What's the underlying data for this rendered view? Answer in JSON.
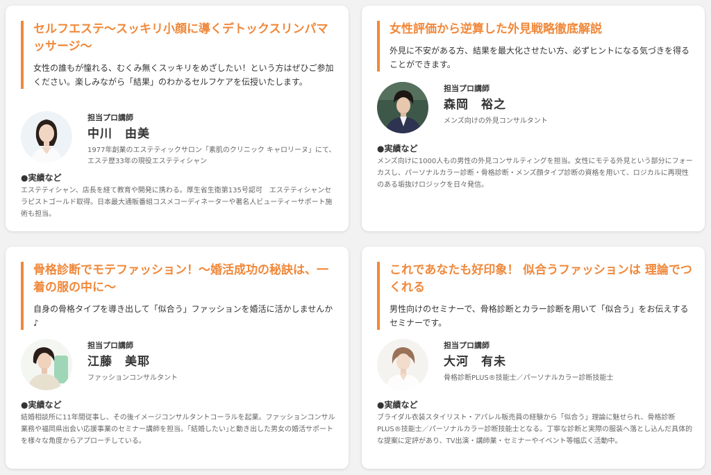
{
  "cards": [
    {
      "title": "セルフエステ〜スッキリ小顔に導くデトックスリンパマッサージ〜",
      "description": "女性の誰もが憧れる、むくみ無くスッキリをめざしたい！という方はぜひご参加ください。楽しみながら「結果」のわかるセルフケアを伝授いたします。",
      "role": "担当プロ講師",
      "name": "中川　由美",
      "profile": "1977年創業のエステティックサロン「素肌のクリニック キャロリーヌ」にて、エステ歴33年の現役エステティシャン",
      "achievements_heading": "●実績など",
      "achievements": "エステティシャン、店長を経て教育や開発に携わる。厚生省生衛第135号認可　エステティシャンセラピストゴールド取得。日本最大通販番組コスメコーディネーターや著名人ビューティーサポート施術も担当。"
    },
    {
      "title": "女性評価から逆算した外見戦略徹底解説",
      "description": "外見に不安がある方、結果を最大化させたい方、必ずヒントになる気づきを得ることができます。",
      "role": "担当プロ講師",
      "name": "森岡　裕之",
      "profile": "メンズ向けの外見コンサルタント",
      "achievements_heading": "●実績など",
      "achievements": "メンズ向けに1000人もの男性の外見コンサルティングを担当。女性にモテる外見という部分にフォーカスし、パーソナルカラー診断・骨格診断・メンズ顔タイプ診断の資格を用いて、ロジカルに再現性のある垢抜けロジックを日々発信。"
    },
    {
      "title": "骨格診断でモテファッション！〜婚活成功の秘訣は、一着の服の中に〜",
      "description": "自身の骨格タイプを導き出して「似合う」ファッションを婚活に活かしませんか♪",
      "role": "担当プロ講師",
      "name": "江藤　美耶",
      "profile": "ファッションコンサルタント",
      "achievements_heading": "●実績など",
      "achievements": "結婚相談所に11年間従事し、その後イメージコンサルタントコーラルを起業。ファッションコンサル業務や福岡県出会い応援事業のセミナー講師を担当。｢結婚したい｣と動き出した男女の婚活サポートを様々な角度からアプローチしている。"
    },
    {
      "title": "これであなたも好印象！ 似合うファッションは 理論でつくれる",
      "description": "男性向けのセミナーで、骨格診断とカラー診断を用いて「似合う」をお伝えするセミナーです。",
      "role": "担当プロ講師",
      "name": "大河　有未",
      "profile": "骨格診断PLUS®技能士／パーソナルカラー診断技能士",
      "achievements_heading": "●実績など",
      "achievements": "ブライダル衣装スタイリスト・アパレル販売員の経験から「似合う」理論に魅せられ、骨格診断PLUS®技能士／パーソナルカラー診断技能士となる。丁寧な診断と実際の服装へ落とし込んだ具体的な提案に定評があり、TV出演・講師業・セミナーやイベント等幅広く活動中。"
    }
  ],
  "colors": {
    "accent": "#f0883a",
    "background": "#f2f2f2",
    "card": "#ffffff",
    "text": "#333333",
    "muted": "#666666"
  }
}
